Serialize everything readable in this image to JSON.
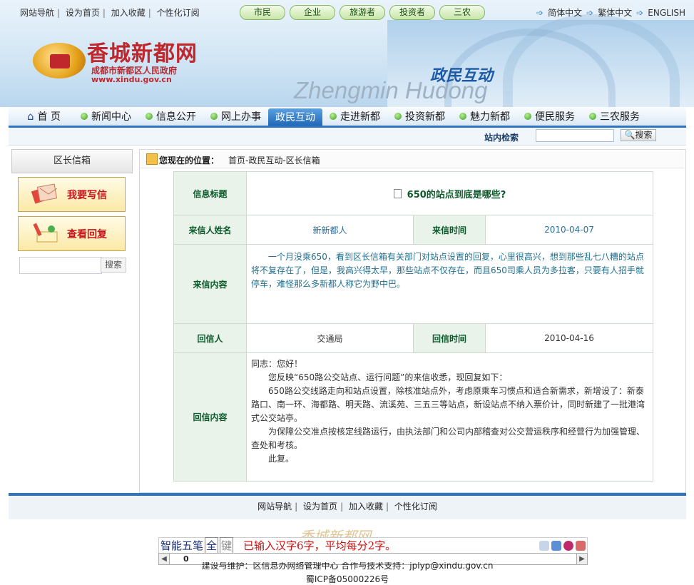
{
  "top_links": [
    "网站导航",
    "设为首页",
    "加入收藏",
    "个性化订阅"
  ],
  "category_buttons": [
    "市民",
    "企业",
    "旅游者",
    "投资者",
    "三农"
  ],
  "languages": [
    "简体中文",
    "繁体中文",
    "ENGLISH"
  ],
  "logo": {
    "title": "香城新都网",
    "subtitle": "成都市新都区人民政府",
    "url": "www.xindu.gov.cn"
  },
  "banner": {
    "cn": "政民互动",
    "en": "Zhengmin Hudong"
  },
  "nav": [
    {
      "label": "首 页",
      "icon": "home-icon"
    },
    {
      "label": "新闻中心"
    },
    {
      "label": "信息公开"
    },
    {
      "label": "网上办事"
    },
    {
      "label": "政民互动",
      "active": true
    },
    {
      "label": "走进新都"
    },
    {
      "label": "投资新都"
    },
    {
      "label": "魅力新都"
    },
    {
      "label": "便民服务"
    },
    {
      "label": "三农服务"
    }
  ],
  "site_search": {
    "label": "站内检索",
    "button": "搜索"
  },
  "sidebar": {
    "title": "区长信箱",
    "write_letter": "我要写信",
    "view_replies": "查看回复",
    "search_button": "搜索"
  },
  "breadcrumb": {
    "label": "您现在的位置：",
    "path": "首页-政民互动-区长信箱"
  },
  "letter": {
    "title_label": "信息标题",
    "title": "650的站点到底是哪些?",
    "sender_label": "来信人姓名",
    "sender": "新新都人",
    "send_time_label": "来信时间",
    "send_time": "2010-04-07",
    "content_label": "来信内容",
    "content": "一个月没乘650，看到区长信箱有关部门对站点设置的回复，心里很高兴，想到那些乱七八糟的站点将不复存在了，但是，我高兴得太早，那些站点不仅存在，而且650司乘人员为多拉客，只要有人招手就停车，难怪那么多新都人称它为野中巴。",
    "replier_label": "回信人",
    "replier": "交通局",
    "reply_time_label": "回信时间",
    "reply_time": "2010-04-16",
    "reply_label": "回信内容",
    "reply": [
      "同志：您好！",
      "您反映“650路公交站点、运行问题”的来信收悉，现回复如下：",
      "650路公交线路走向和站点设置，除核准站点外，考虑原乘车习惯点和适合新需求，新增设了：新泰路口、南一环、海都路、明天路、流溪苑、三五三等站点，新设站点不纳入票价计，同时新建了一批港湾式公交站亭。",
      "为保障公交准点按核定线路运行，由执法部门和公司内部稽查对公交营运秩序和经营行为加强管理、查处和考核。",
      "此复。"
    ]
  },
  "footer_links": [
    "网站导航",
    "设为首页",
    "加入收藏",
    "个性化订阅"
  ],
  "footer_logo": "香城新都网",
  "ime": {
    "mode": "智能五笔",
    "full": "全",
    "key": "键",
    "message": "已输入汉字6字，平均每分2字。",
    "scroll_value": "0"
  },
  "copyright": {
    "line1": "建设与维护：区信息办网络管理中心  合作与技术支持：jplyp@xindu.gov.cn",
    "line2": "蜀ICP备05000226号"
  }
}
